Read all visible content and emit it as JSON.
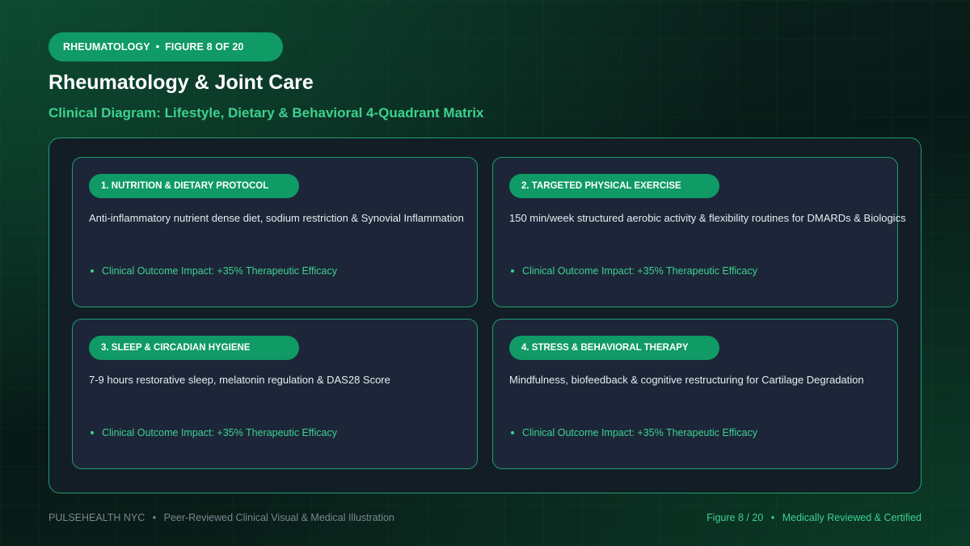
{
  "header": {
    "category": "RHEUMATOLOGY",
    "figure_label": "FIGURE 8 OF 20",
    "title": "Rheumatology & Joint Care",
    "subtitle": "Clinical Diagram: Lifestyle, Dietary & Behavioral 4-Quadrant Matrix"
  },
  "quadrants": [
    {
      "tag": "1. NUTRITION & DIETARY PROTOCOL",
      "description": "Anti-inflammatory nutrient dense diet, sodium restriction & Synovial Inflammation",
      "impact": "Clinical Outcome Impact: +35% Therapeutic Efficacy"
    },
    {
      "tag": "2. TARGETED PHYSICAL EXERCISE",
      "description": "150 min/week structured aerobic activity & flexibility routines for DMARDs & Biologics",
      "impact": "Clinical Outcome Impact: +35% Therapeutic Efficacy"
    },
    {
      "tag": "3. SLEEP & CIRCADIAN HYGIENE",
      "description": "7-9 hours restorative sleep, melatonin regulation & DAS28 Score",
      "impact": "Clinical Outcome Impact: +35% Therapeutic Efficacy"
    },
    {
      "tag": "4. STRESS & BEHAVIORAL THERAPY",
      "description": "Mindfulness, biofeedback & cognitive restructuring for Cartilage Degradation",
      "impact": "Clinical Outcome Impact: +35% Therapeutic Efficacy"
    }
  ],
  "footer": {
    "brand": "PULSEHEALTH NYC",
    "caption": "Peer-Reviewed Clinical Visual & Medical Illustration",
    "figure": "Figure 8 / 20",
    "status": "Medically Reviewed & Certified"
  },
  "separator": "•",
  "colors": {
    "accent": "#0f9a66",
    "accent_text": "#3fd08f",
    "panel": "#121d26",
    "card": "#1c2638"
  }
}
